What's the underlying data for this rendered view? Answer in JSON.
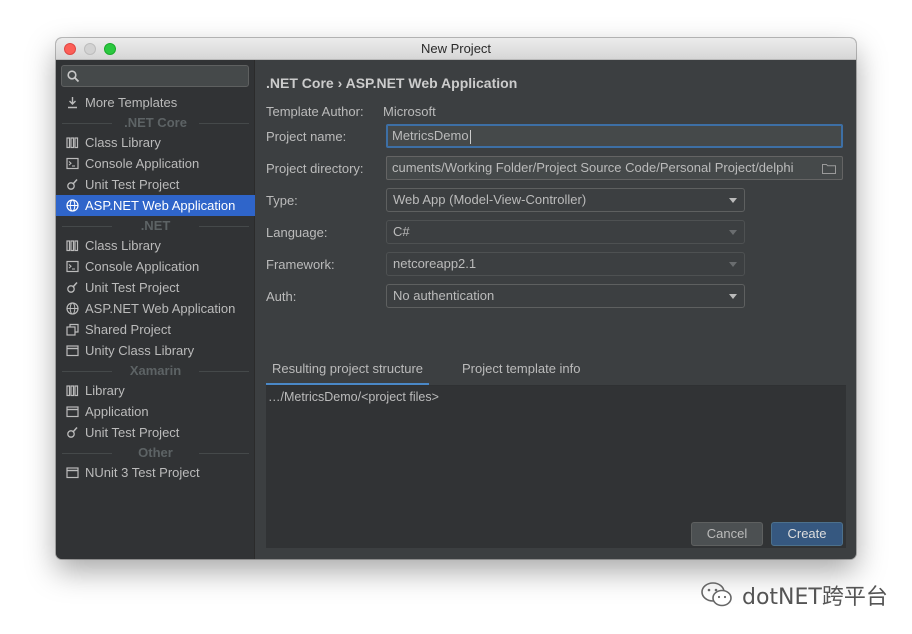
{
  "window": {
    "title": "New Project"
  },
  "sidebar": {
    "search": {
      "placeholder": ""
    },
    "items": [
      {
        "label": "More Templates",
        "icon": "download-icon"
      },
      {
        "group": ".NET Core"
      },
      {
        "label": "Class Library",
        "icon": "library-icon"
      },
      {
        "label": "Console Application",
        "icon": "console-icon"
      },
      {
        "label": "Unit Test Project",
        "icon": "test-icon"
      },
      {
        "label": "ASP.NET Web Application",
        "icon": "globe-icon",
        "selected": true
      },
      {
        "group": ".NET"
      },
      {
        "label": "Class Library",
        "icon": "library-icon"
      },
      {
        "label": "Console Application",
        "icon": "console-icon"
      },
      {
        "label": "Unit Test Project",
        "icon": "test-icon"
      },
      {
        "label": "ASP.NET Web Application",
        "icon": "globe-icon"
      },
      {
        "label": "Shared Project",
        "icon": "shared-project-icon"
      },
      {
        "label": "Unity Class Library",
        "icon": "window-icon"
      },
      {
        "group": "Xamarin"
      },
      {
        "label": "Library",
        "icon": "library-icon"
      },
      {
        "label": "Application",
        "icon": "window-icon"
      },
      {
        "label": "Unit Test Project",
        "icon": "test-icon"
      },
      {
        "group": "Other"
      },
      {
        "label": "NUnit 3 Test Project",
        "icon": "window-icon"
      }
    ]
  },
  "main": {
    "breadcrumb": ".NET Core › ASP.NET Web Application",
    "template_author_label": "Template Author:",
    "template_author": "Microsoft",
    "project_name_label": "Project name:",
    "project_name": "MetricsDemo",
    "project_directory_label": "Project directory:",
    "project_directory": "cuments/Working Folder/Project Source Code/Personal Project/delphi",
    "type_label": "Type:",
    "type_value": "Web App (Model-View-Controller)",
    "language_label": "Language:",
    "language_value": "C#",
    "framework_label": "Framework:",
    "framework_value": "netcoreapp2.1",
    "auth_label": "Auth:",
    "auth_value": "No authentication",
    "tabs": [
      "Resulting project structure",
      "Project template info"
    ],
    "structure_text": "…/MetricsDemo/<project files>",
    "cancel_label": "Cancel",
    "create_label": "Create"
  },
  "watermark": {
    "text": "dotNET跨平台"
  },
  "colors": {
    "selection": "#2f65ca",
    "accent_button": "#365880",
    "background": "#3c3f41"
  }
}
